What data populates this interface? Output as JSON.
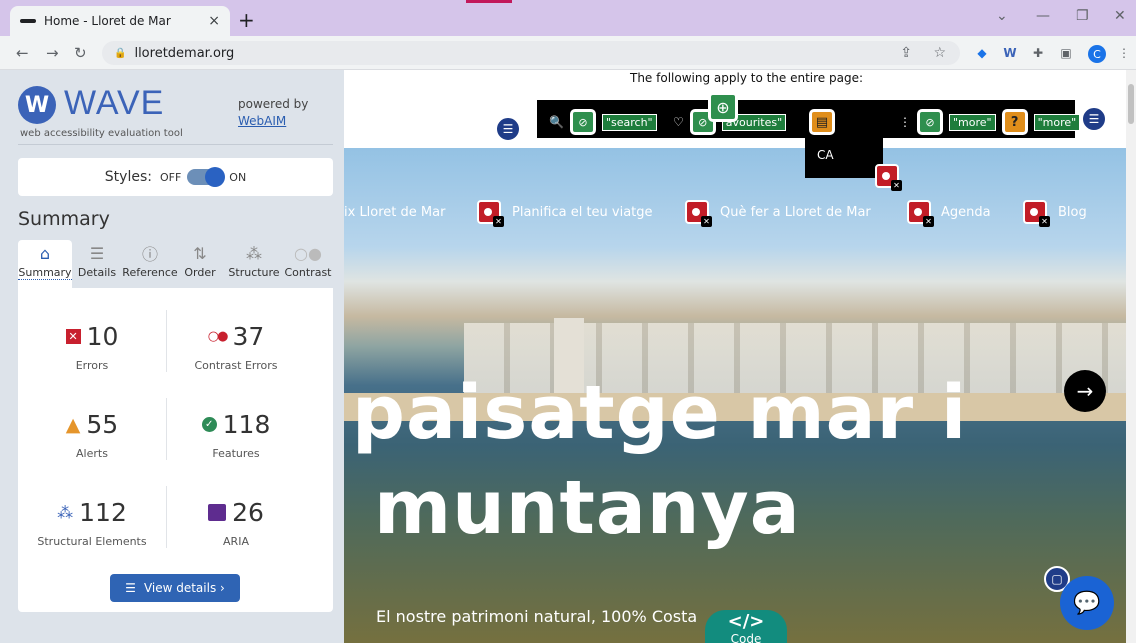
{
  "browser": {
    "tab_title": "Home - Lloret de Mar",
    "tab_close": "×",
    "new_tab": "+",
    "url": "lloretdemar.org",
    "avatar_letter": "C",
    "win_min": "—",
    "win_max": "❐",
    "win_close": "✕",
    "chevron": "⌄"
  },
  "wave": {
    "logo_text": "WAVE",
    "subtitle": "web accessibility evaluation tool",
    "powered_by": "powered by",
    "webaim": "WebAIM",
    "styles_label": "Styles:",
    "styles_off": "OFF",
    "styles_on": "ON",
    "summary_title": "Summary",
    "tabs": [
      {
        "label": "Summary",
        "icon": "home-icon"
      },
      {
        "label": "Details",
        "icon": "list-icon"
      },
      {
        "label": "Reference",
        "icon": "info-icon"
      },
      {
        "label": "Order",
        "icon": "order-icon"
      },
      {
        "label": "Structure",
        "icon": "structure-icon"
      },
      {
        "label": "Contrast",
        "icon": "contrast-icon"
      }
    ],
    "stats": {
      "errors": {
        "value": "10",
        "label": "Errors"
      },
      "contrast": {
        "value": "37",
        "label": "Contrast Errors"
      },
      "alerts": {
        "value": "55",
        "label": "Alerts"
      },
      "features": {
        "value": "118",
        "label": "Features"
      },
      "structural": {
        "value": "112",
        "label": "Structural Elements"
      },
      "aria": {
        "value": "26",
        "label": "ARIA"
      }
    },
    "view_details": "View details ›"
  },
  "page": {
    "apply_notice": "The following apply to the entire page:",
    "toolbar": {
      "search_tag": "\"search\"",
      "favourites_tag": "avourites\"",
      "more_tag_1": "\"more\"",
      "more_tag_2": "\"more\""
    },
    "ca_label": "CA",
    "menu": [
      "ix Lloret de Mar",
      "Planifica el teu viatge",
      "Què fer a Lloret de Mar",
      "Agenda",
      "Blog"
    ],
    "hero_line1": "paisatge mar i",
    "hero_line2": "muntanya",
    "tagline": "El nostre patrimoni natural, 100% Costa",
    "code_label": "Code",
    "code_symbol": "</>"
  },
  "colors": {
    "wave_blue": "#3b63b8",
    "error_red": "#c8202e",
    "alert_orange": "#e5952b",
    "feature_green": "#2e8b57",
    "aria_purple": "#5e2c8f"
  }
}
